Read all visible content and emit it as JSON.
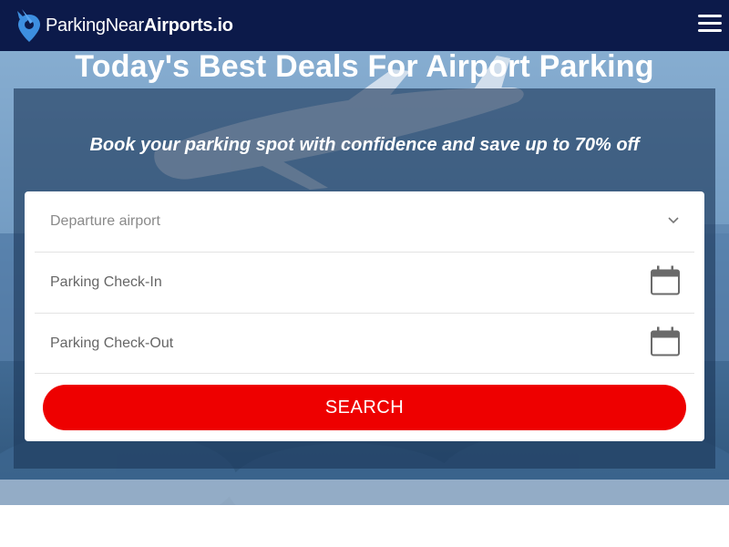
{
  "header": {
    "logo": {
      "part1": "Parking",
      "part2": "Near",
      "part3": "Airports.io"
    },
    "menu_icon": "hamburger-menu-icon",
    "bg_color": "#0c1a4a"
  },
  "hero": {
    "title": "Today's Best Deals For Airport Parking",
    "subtitle": "Book your parking spot with confidence and save up to 70% off"
  },
  "search_form": {
    "departure_placeholder": "Departure airport",
    "checkin_label": "Parking Check-In",
    "checkout_label": "Parking Check-Out",
    "search_label": "SEARCH",
    "icons": [
      "chevron-down-icon",
      "calendar-icon",
      "calendar-icon"
    ],
    "button_color": "#ee0000"
  }
}
